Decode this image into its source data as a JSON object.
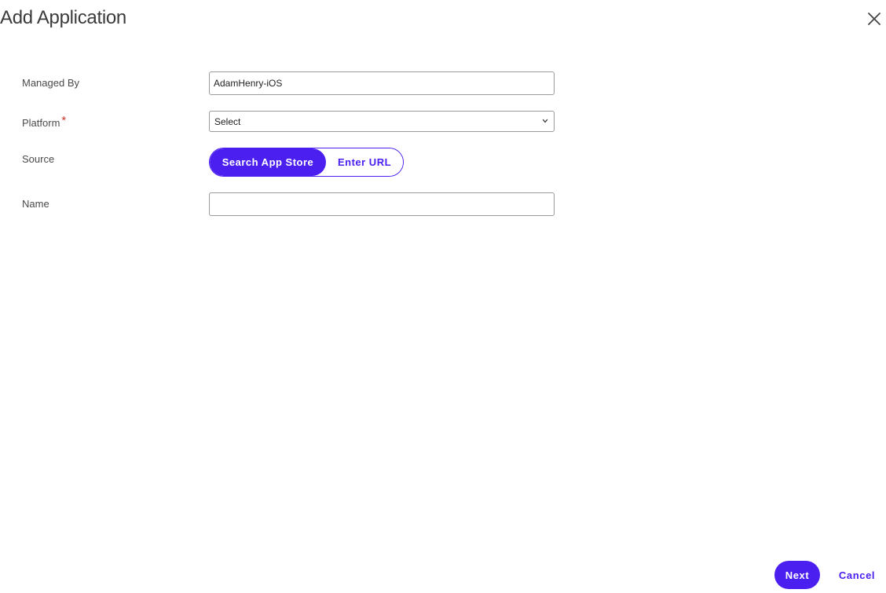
{
  "dialog": {
    "title": "Add Application"
  },
  "form": {
    "managed_by": {
      "label": "Managed By",
      "value": "AdamHenry-iOS"
    },
    "platform": {
      "label": "Platform",
      "required_marker": "*",
      "selected": "Select"
    },
    "source": {
      "label": "Source",
      "options": [
        "Search App Store",
        "Enter URL"
      ],
      "selected": "Search App Store"
    },
    "name": {
      "label": "Name",
      "value": ""
    }
  },
  "footer": {
    "next_label": "Next",
    "cancel_label": "Cancel"
  },
  "colors": {
    "accent": "#4b1ff0",
    "required": "#d9352c"
  },
  "icons": {
    "close": "close-icon",
    "dropdown": "chevron-down-icon"
  }
}
